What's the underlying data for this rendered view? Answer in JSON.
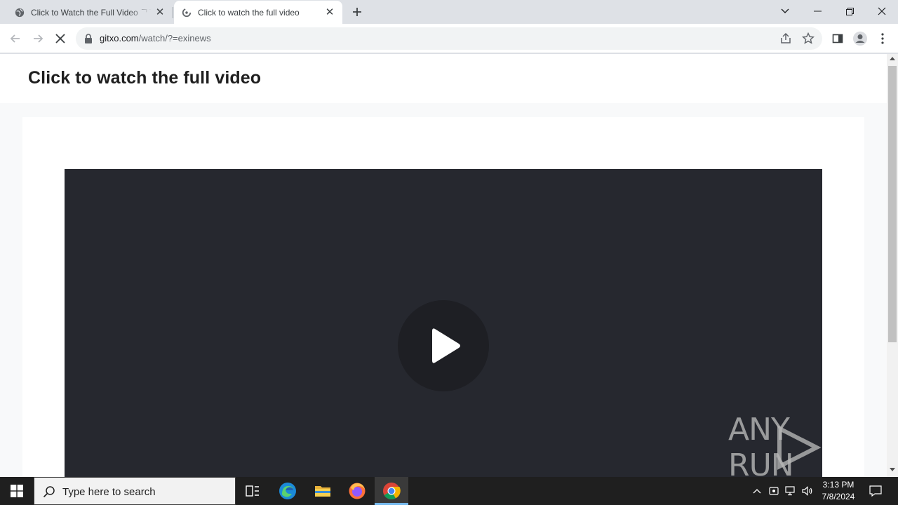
{
  "browser": {
    "tabs": [
      {
        "title": "Click to Watch the Full Video ᄀᄀ",
        "active": false
      },
      {
        "title": "Click to watch the full video",
        "active": true
      }
    ],
    "address": {
      "domain": "gitxo.com",
      "path": "/watch/?=exinews"
    }
  },
  "page": {
    "title": "Click to watch the full video"
  },
  "watermark": {
    "text": "ANY RUN"
  },
  "taskbar": {
    "search_placeholder": "Type here to search",
    "time": "3:13 PM",
    "date": "7/8/2024"
  },
  "colors": {
    "video_bg": "#26282f",
    "play_bg": "#1e1f24",
    "taskbar_bg": "#1f1f1f",
    "tabstrip_bg": "#dee1e6"
  }
}
